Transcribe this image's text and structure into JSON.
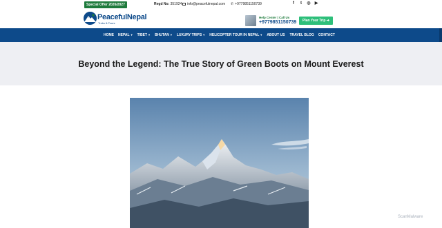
{
  "topbar": {
    "offer": "Special Offer 2026/2027",
    "regd_label": "Regd No:",
    "regd_value": "351924",
    "email": "info@peacefulnepal.com",
    "phone": "+9779851150739",
    "socials": [
      "facebook-icon",
      "twitter-icon",
      "instagram-icon",
      "youtube-icon"
    ]
  },
  "logo": {
    "name_part1": "Peaceful",
    "name_part2": "Nepal",
    "sub": "Treks & Tours"
  },
  "help": {
    "label": "Help Center | Call Us",
    "phone": "+9779851150739"
  },
  "plan_button": "Plan Your Trip  ➔",
  "nav": [
    {
      "label": "HOME",
      "dropdown": false
    },
    {
      "label": "NEPAL",
      "dropdown": true
    },
    {
      "label": "TIBET",
      "dropdown": true
    },
    {
      "label": "BHUTAN",
      "dropdown": true
    },
    {
      "label": "LUXURY TRIPS",
      "dropdown": true
    },
    {
      "label": "HELICOPTER TOUR IN NEPAL",
      "dropdown": true
    },
    {
      "label": "ABOUT US",
      "dropdown": false
    },
    {
      "label": "TRAVEL BLOG",
      "dropdown": false
    },
    {
      "label": "CONTACT",
      "dropdown": false
    }
  ],
  "page": {
    "title": "Beyond the Legend: The True Story of Green Boots on Mount Everest"
  },
  "watermark": "ScanMalware",
  "colors": {
    "brand_blue": "#0d4a8a",
    "brand_green": "#1e7a3c",
    "button_green": "#2dbf7a",
    "hero_bg": "#eeeff3"
  }
}
